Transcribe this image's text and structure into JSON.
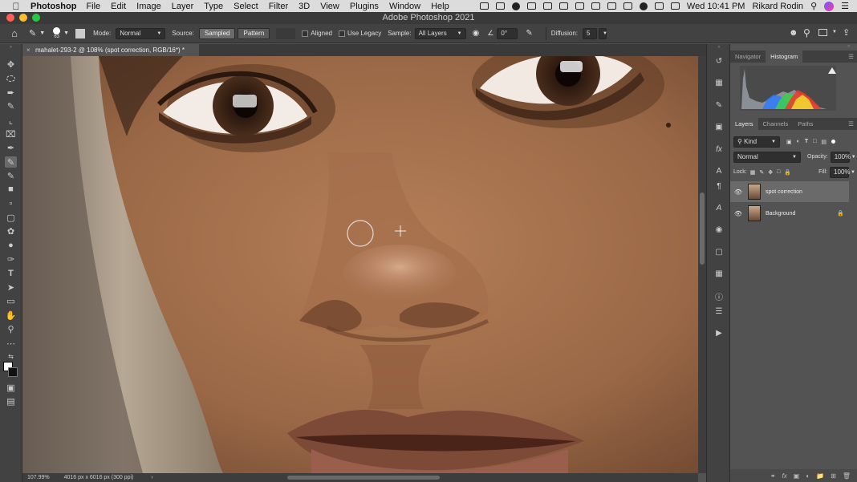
{
  "menubar": {
    "app": "Photoshop",
    "items": [
      "File",
      "Edit",
      "Image",
      "Layer",
      "Type",
      "Select",
      "Filter",
      "3D",
      "View",
      "Plugins",
      "Window",
      "Help"
    ],
    "clock": "Wed 10:41 PM",
    "user": "Rikard Rodin"
  },
  "window": {
    "title": "Adobe Photoshop 2021"
  },
  "options": {
    "brush_size": "63",
    "mode_label": "Mode:",
    "mode_value": "Normal",
    "source_label": "Source:",
    "sampled_label": "Sampled",
    "pattern_label": "Pattern",
    "aligned_label": "Aligned",
    "legacy_label": "Use Legacy",
    "sample_label": "Sample:",
    "sample_value": "All Layers",
    "angle_value": "0°",
    "diffusion_label": "Diffusion:",
    "diffusion_value": "5"
  },
  "document": {
    "tab_title": "mahalet-293-2 @ 108% (spot correction, RGB/16*) *"
  },
  "status": {
    "zoom": "107.99%",
    "size": "4016 px x 6016 px (300 ppi)"
  },
  "panels": {
    "top_tabs": [
      "Navigator",
      "Histogram"
    ],
    "layer_tabs": [
      "Layers",
      "Channels",
      "Paths"
    ],
    "kind_label": "Kind",
    "blend_mode": "Normal",
    "opacity_label": "Opacity:",
    "opacity_value": "100%",
    "lock_label": "Lock:",
    "fill_label": "Fill:",
    "fill_value": "100%",
    "layers": [
      {
        "name": "spot correction"
      },
      {
        "name": "Background"
      }
    ]
  }
}
